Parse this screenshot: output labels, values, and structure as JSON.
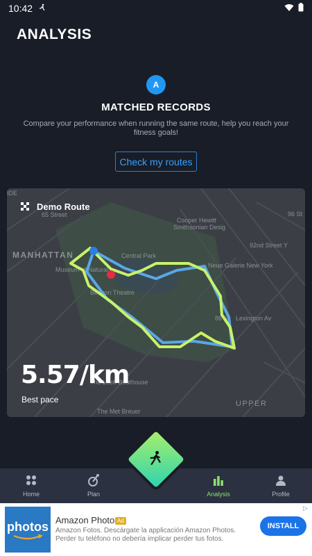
{
  "status_bar": {
    "time": "10:42"
  },
  "header": {
    "title": "ANALYSIS"
  },
  "records": {
    "badge_letter": "A",
    "title": "MATCHED RECORDS",
    "description": "Compare your performance when running the same route, help you reach your fitness goals!",
    "button_label": "Check my routes"
  },
  "map_card": {
    "route_name": "Demo Route",
    "pace_value": "5.57/km",
    "pace_label": "Best pace",
    "map_labels": [
      "IDE",
      "65 Street",
      "MANHATTAN",
      "Central Park",
      "Cooper Hewitt",
      "Smithsonian Desig",
      "92nd Street Y",
      "Neue Galerie New York",
      "Museum of Natural",
      "Beacon Theatre",
      "86 St",
      "Lexington Av",
      "96 St",
      "UPPER",
      "The Loeb Boathouse",
      "The Met Breuer"
    ]
  },
  "nav": {
    "items": [
      {
        "label": "Home",
        "icon": "grid-icon"
      },
      {
        "label": "Plan",
        "icon": "plan-icon"
      },
      {
        "label": "",
        "icon": "runner-icon"
      },
      {
        "label": "Analysis",
        "icon": "bar-chart-icon"
      },
      {
        "label": "Profile",
        "icon": "person-icon"
      }
    ],
    "active": "Analysis"
  },
  "ad": {
    "logo_text": "photos",
    "name": "Amazon Photos",
    "tag": "Ad",
    "description": "Amazon Fotos. Descárgate la applicación Amazon Photos. Perder tu teléfono no debería implicar perder tus fotos.",
    "install_label": "INSTALL"
  },
  "colors": {
    "background": "#181d27",
    "accent_blue": "#2196f3",
    "route_green": "#c8f26a",
    "route_blue": "#5aa7e6",
    "active_nav": "#8be06a"
  }
}
